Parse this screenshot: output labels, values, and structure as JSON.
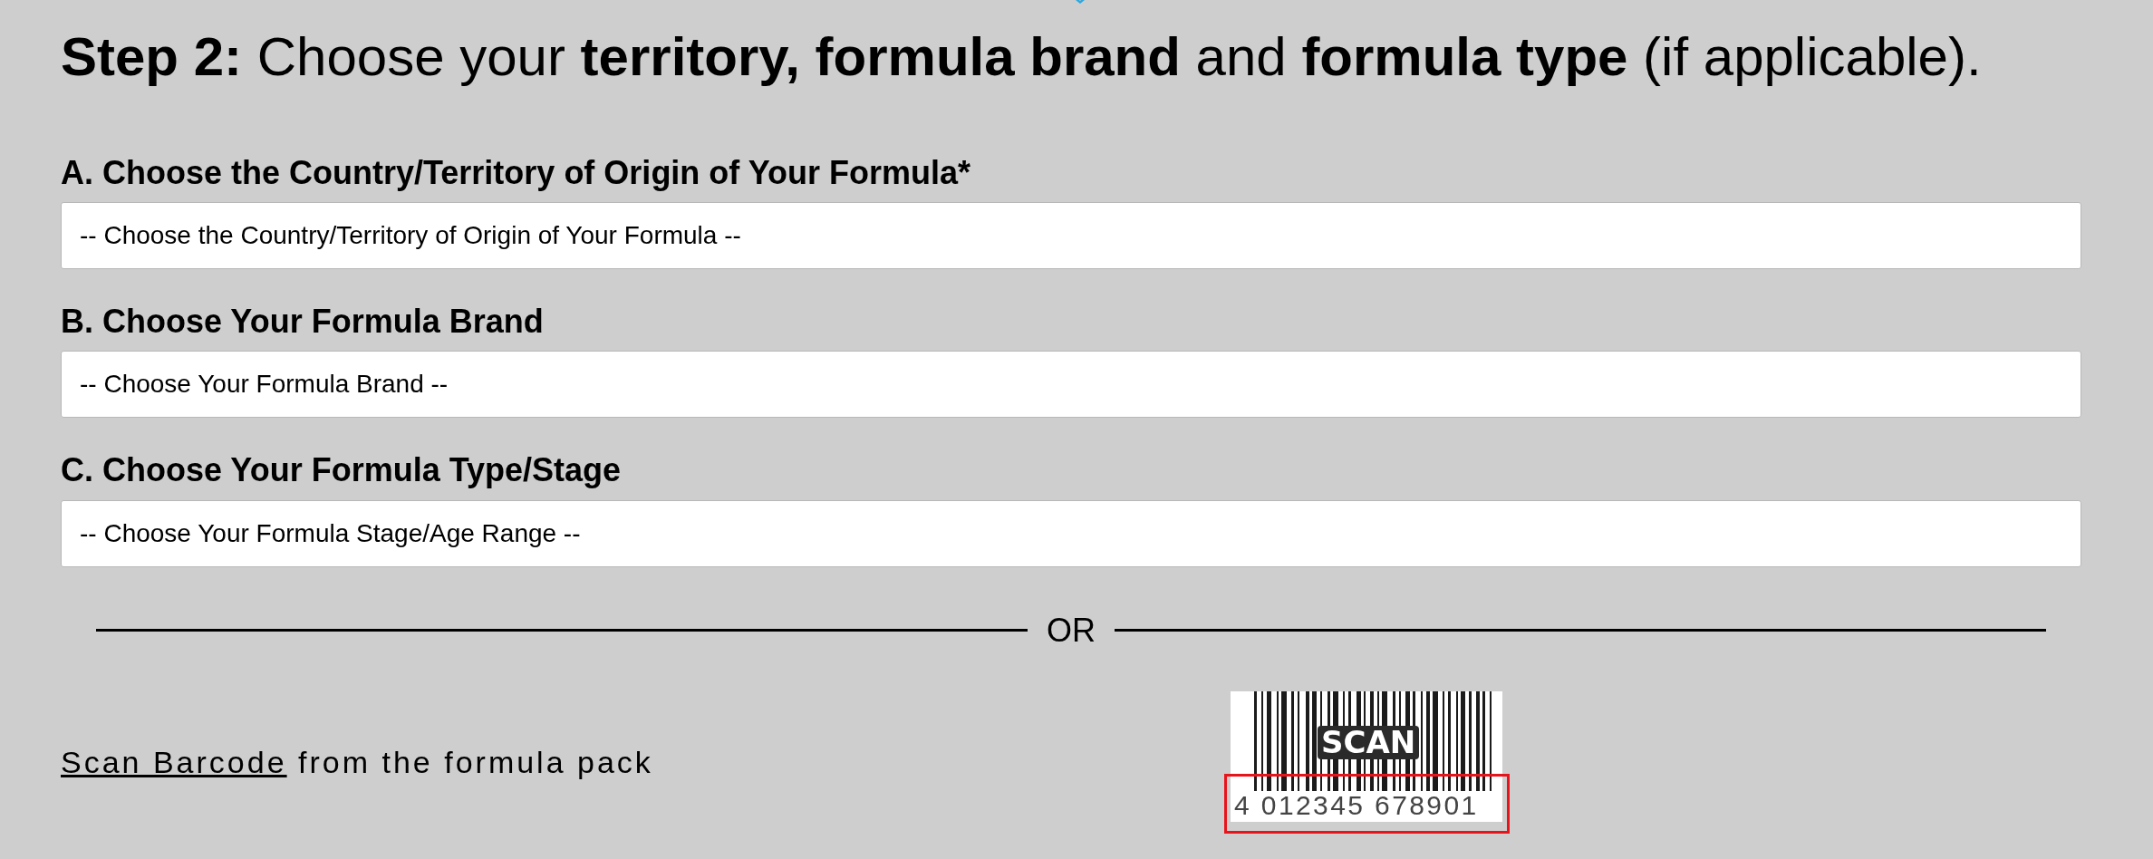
{
  "heading": "**Step 2:** Choose your **territory, formula brand** and **formula type** (if applicable).",
  "fields": [
    {
      "label": "A. Choose the Country/Territory of Origin of Your Formula*",
      "value": "-- Choose the Country/Territory of Origin of Your Formula --"
    },
    {
      "label": "B. Choose Your Formula Brand",
      "value": "-- Choose Your Formula Brand --"
    },
    {
      "label": "C. Choose Your Formula Type/Stage",
      "value": "-- Choose Your Formula Stage/Age Range --"
    }
  ],
  "divider": {
    "label": "OR"
  },
  "scan": {
    "link": "Scan Barcode",
    "text": "from the formula pack"
  },
  "barcode": {
    "caption": "SCAN",
    "digits": "4 012345 678901",
    "digits_highlighted": true
  }
}
